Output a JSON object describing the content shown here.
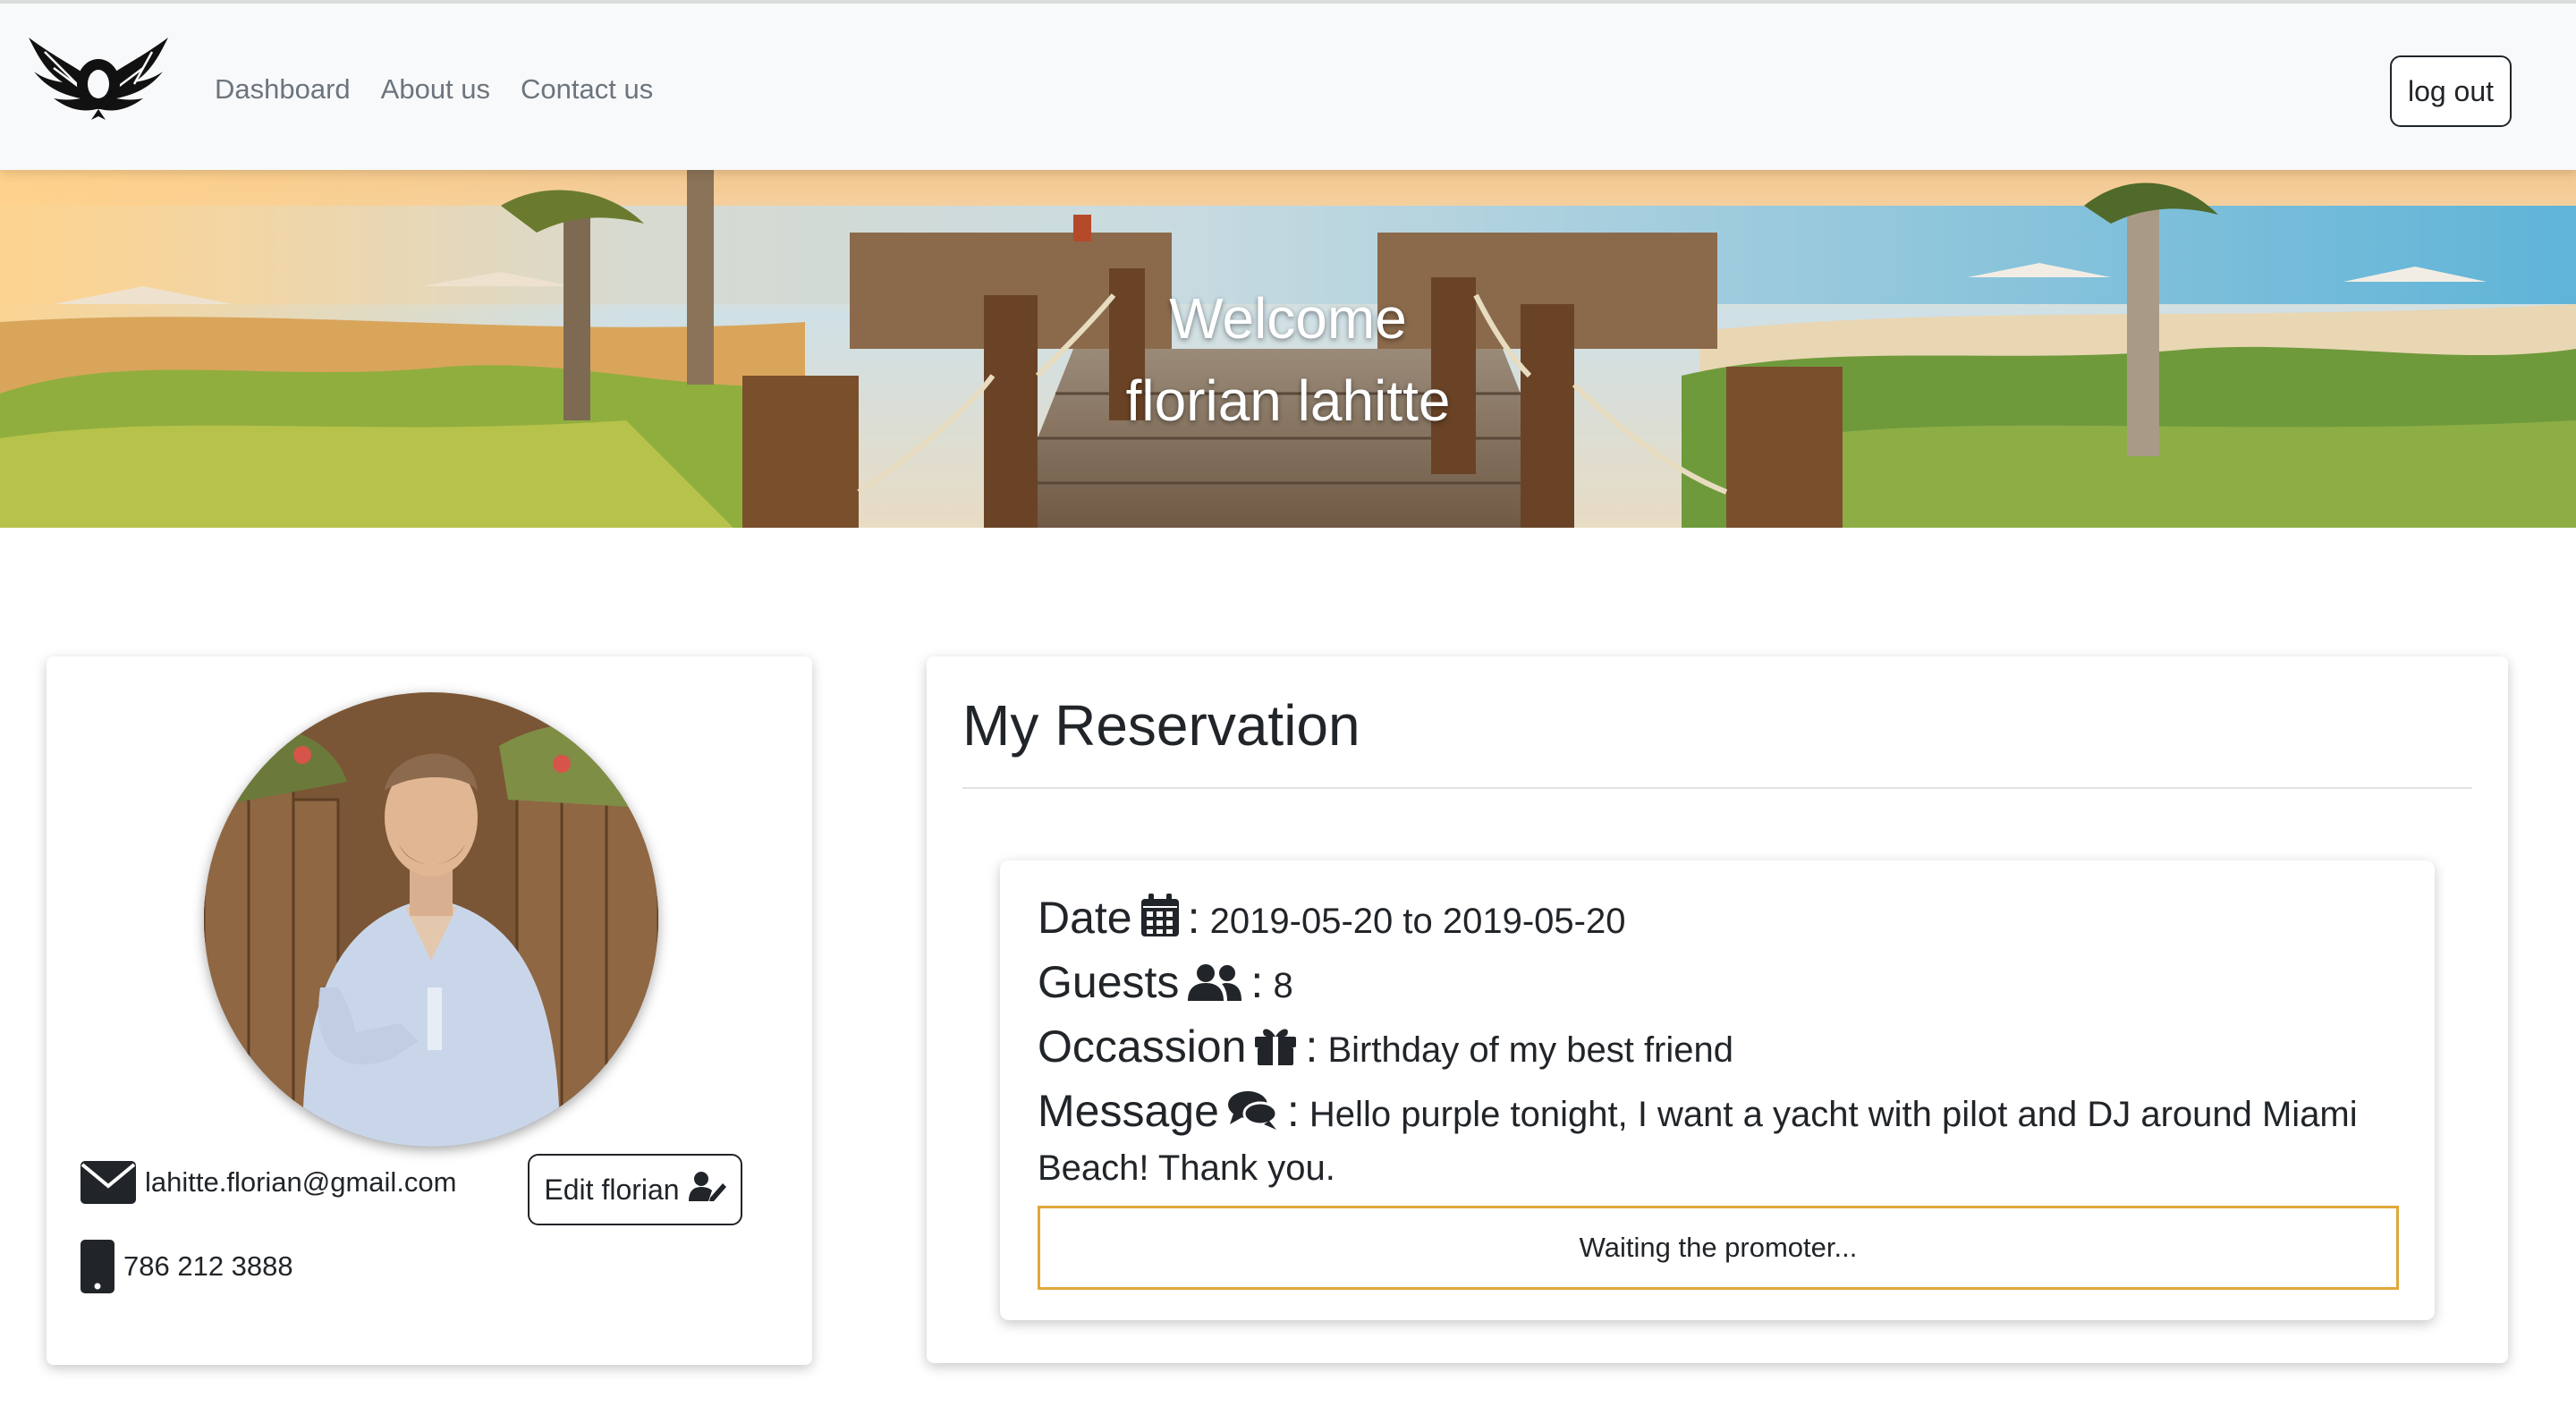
{
  "nav": {
    "links": [
      "Dashboard",
      "About us",
      "Contact us"
    ],
    "logout_label": "log out"
  },
  "hero": {
    "line1": "Welcome",
    "line2": "florian lahitte"
  },
  "profile": {
    "email": "lahitte.florian@gmail.com",
    "phone": "786 212 3888",
    "edit_label": "Edit florian"
  },
  "reservation": {
    "title": "My Reservation",
    "date_label": "Date",
    "date_value": "2019-05-20 to 2019-05-20",
    "guests_label": "Guests",
    "guests_value": "8",
    "occasion_label": "Occassion",
    "occasion_value": "Birthday of my best friend",
    "message_label": "Message",
    "message_value": "Hello purple tonight, I want a yacht with pilot and DJ around Miami Beach! Thank you.",
    "separator": ":",
    "status": "Waiting the promoter..."
  },
  "icons": {
    "logo": "winged-o-logo-icon",
    "email": "envelope-icon",
    "phone": "mobile-phone-icon",
    "edit": "user-edit-icon",
    "date": "calendar-icon",
    "guests": "users-icon",
    "occasion": "gift-icon",
    "message": "comments-icon"
  },
  "colors": {
    "navbar_bg": "#f8f9fa",
    "status_border": "#e0a83a",
    "text": "#212529",
    "nav_link": "#6c757d"
  }
}
